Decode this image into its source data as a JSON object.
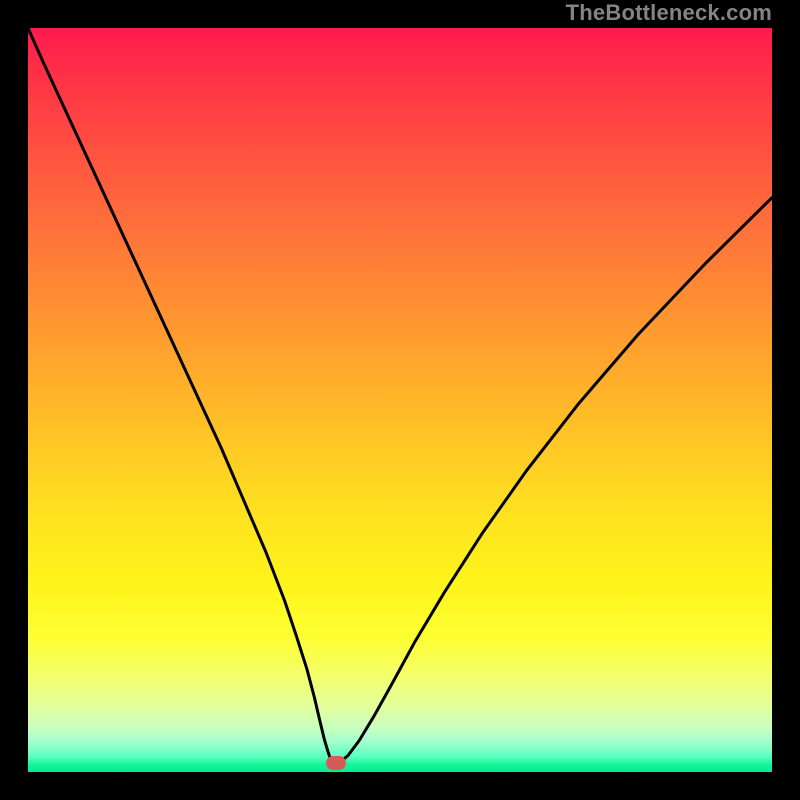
{
  "watermark": "TheBottleneck.com",
  "colors": {
    "frame": "#000000",
    "curve": "#000000",
    "marker": "#d65a5a"
  },
  "chart_data": {
    "type": "line",
    "title": "",
    "xlabel": "",
    "ylabel": "",
    "xlim": [
      0,
      100
    ],
    "ylim": [
      0,
      100
    ],
    "grid": false,
    "legend": false,
    "series": [
      {
        "name": "bottleneck-curve",
        "x": [
          0,
          2,
          5,
          8,
          11,
          14,
          17,
          20,
          23,
          26,
          29,
          32,
          34.5,
          36,
          37.5,
          38.5,
          39.2,
          39.8,
          40.3,
          40.7,
          41,
          41.5,
          42,
          43,
          44.5,
          46.5,
          49,
          52,
          56,
          61,
          67,
          74,
          82,
          91,
          100
        ],
        "y": [
          100,
          95.5,
          89,
          82.5,
          76,
          69.5,
          63,
          56.5,
          50,
          43.5,
          36.5,
          29.5,
          23,
          18.5,
          13.8,
          10,
          7,
          4.5,
          2.8,
          1.6,
          1.2,
          1.2,
          1.4,
          2.2,
          4.2,
          7.5,
          12,
          17.5,
          24.2,
          32,
          40.5,
          49.5,
          58.8,
          68.3,
          77.2
        ]
      }
    ],
    "marker": {
      "x": 41.4,
      "y": 1.2
    },
    "gradient_stops": [
      {
        "pos": 0,
        "color": "#ff1a4d"
      },
      {
        "pos": 7,
        "color": "#ff3346"
      },
      {
        "pos": 18,
        "color": "#ff5640"
      },
      {
        "pos": 30,
        "color": "#ff7a38"
      },
      {
        "pos": 42,
        "color": "#ff9e2f"
      },
      {
        "pos": 54,
        "color": "#ffc226"
      },
      {
        "pos": 66,
        "color": "#ffe31f"
      },
      {
        "pos": 75,
        "color": "#fff41c"
      },
      {
        "pos": 82,
        "color": "#fdff33"
      },
      {
        "pos": 87,
        "color": "#f4ff6a"
      },
      {
        "pos": 91,
        "color": "#e4ff9a"
      },
      {
        "pos": 94,
        "color": "#c9ffbe"
      },
      {
        "pos": 96,
        "color": "#a0ffce"
      },
      {
        "pos": 98,
        "color": "#58ffbe"
      },
      {
        "pos": 99,
        "color": "#16f59a"
      },
      {
        "pos": 100,
        "color": "#06e88e"
      }
    ]
  }
}
